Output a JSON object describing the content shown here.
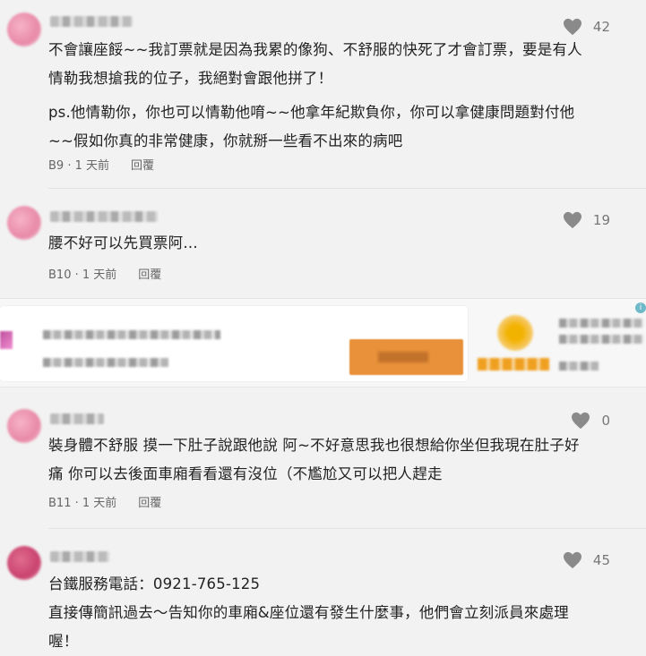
{
  "comments": [
    {
      "likes": "42",
      "lines": [
        "不會讓座餒~~我訂票就是因為我累的像狗、不舒服的快死了才會訂票，要是有人",
        "情勒我想搶我的位子，我絕對會跟他拼了！",
        "ps.他情勒你，你也可以情勒他唷~~他拿年紀欺負你，你可以拿健康問題對付他",
        "~~假如你真的非常健康，你就掰一些看不出來的病吧"
      ],
      "floor": "B9",
      "time": "1 天前",
      "reply": "回覆"
    },
    {
      "likes": "19",
      "lines": [
        "腰不好可以先買票阿…"
      ],
      "floor": "B10",
      "time": "1 天前",
      "reply": "回覆"
    },
    {
      "likes": "0",
      "lines": [
        "裝身體不舒服 摸一下肚子說跟他說 阿~不好意思我也很想給你坐但我現在肚子好",
        "痛 你可以去後面車廂看看還有沒位（不尷尬又可以把人趕走"
      ],
      "floor": "B11",
      "time": "1 天前",
      "reply": "回覆"
    },
    {
      "likes": "45",
      "lines": [
        "台鐵服務電話：0921-765-125",
        "直接傳簡訊過去～告知你的車廂&座位還有發生什麼事，他們會立刻派員來處理",
        "喔！"
      ]
    }
  ],
  "ad": {
    "corner_glyph": "i"
  },
  "icons": {
    "like": "heart-icon"
  },
  "colors": {
    "heart": "#8a8a8a",
    "ad_button": "#e8913a"
  },
  "separator": "·"
}
